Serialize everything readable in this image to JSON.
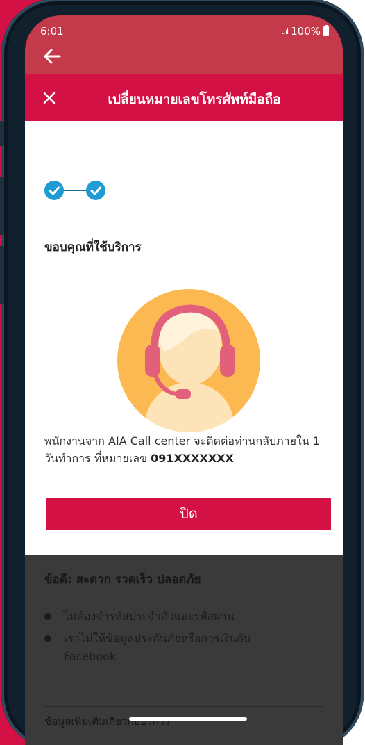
{
  "status_bar": {
    "time": "6:01",
    "signal": "..ıl",
    "battery": "100%"
  },
  "app_bar": {
    "back_icon": "arrow-left-icon"
  },
  "sheet": {
    "title": "เปลี่ยนหมายเลขโทรศัพท์มือถือ",
    "close_icon": "close-icon",
    "steps_completed": 2,
    "steps_total": 2,
    "thanks": "ขอบคุณที่ใช้บริการ",
    "message_line1": "พนักงานจาก AIA Call center จะติดต่อท่านกลับภายใน 1",
    "message_line2_prefix": "วันทำการ ที่หมายเลข ",
    "phone_number": "091XXXXXXX",
    "close_button": "ปิด"
  },
  "background_page": {
    "advantages_title": "ข้อดี: สะดวก รวดเร็ว ปลอดภัย",
    "bullets": [
      "ไม่ต้องจำรหัสประจำตัวและรหัสผ่าน",
      "เราไม่ให้ข้อมูลประกันภัยหรือการเงินกับ",
      "Facebook"
    ],
    "partial_text": "ข้อมูลเพิ่มเติมเกี่ยวกับบริการ"
  },
  "colors": {
    "brand_red": "#d31145",
    "app_bar_red": "#c43a4b",
    "step_blue": "#1f9bd4",
    "illustration_yellow": "#fdb951",
    "headset_pink": "#e2607a",
    "face_cream": "#fde4b8",
    "overlay_gray": "#3a3a3a"
  }
}
